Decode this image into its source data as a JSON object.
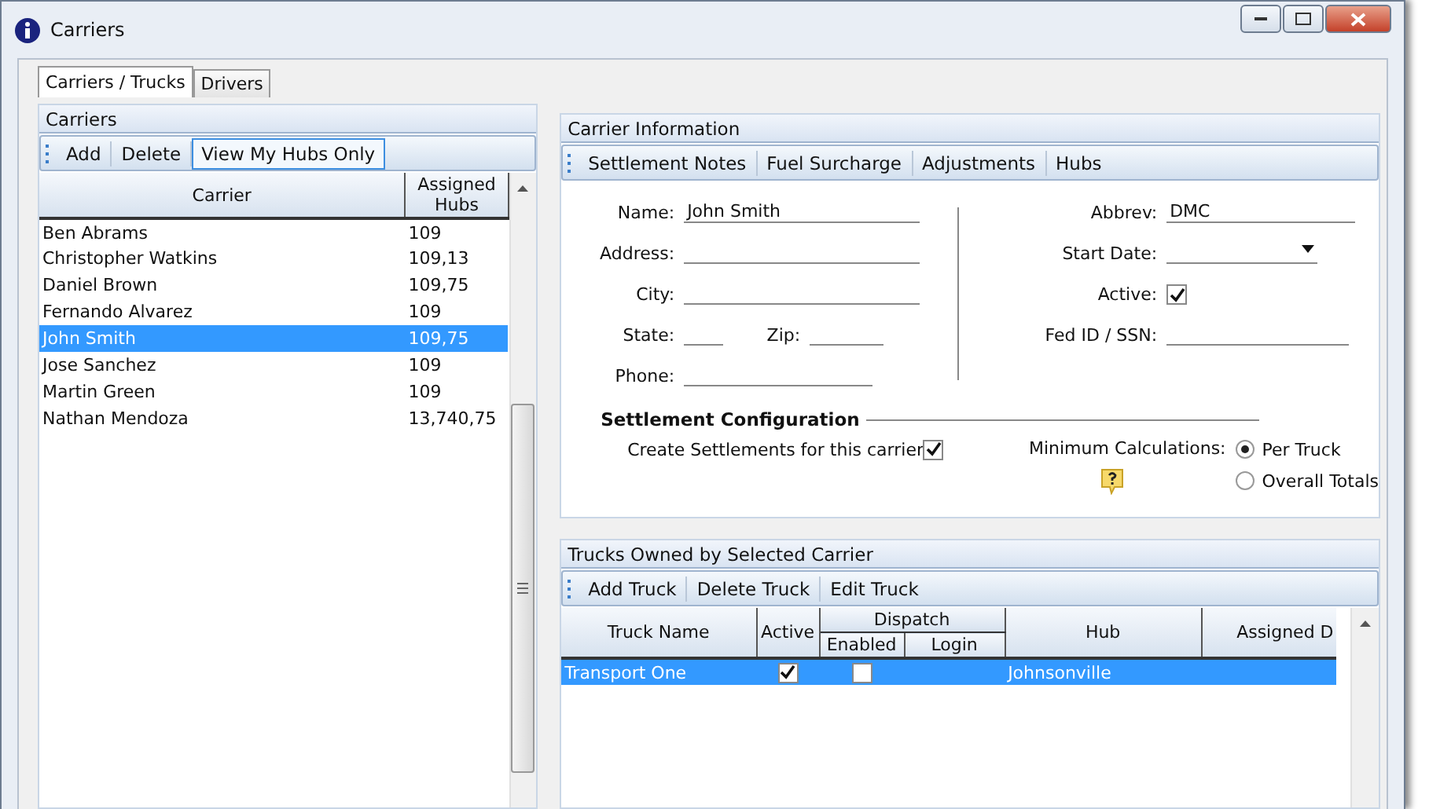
{
  "window": {
    "title": "Carriers"
  },
  "tabs": [
    {
      "label": "Carriers / Trucks",
      "selected": true
    },
    {
      "label": "Drivers",
      "selected": false
    }
  ],
  "carriers": {
    "title": "Carriers",
    "toolbar": [
      {
        "label": "Add",
        "highlighted": false
      },
      {
        "label": "Delete",
        "highlighted": false
      },
      {
        "label": "View My Hubs Only",
        "highlighted": true
      }
    ],
    "columns": [
      "Carrier",
      "Assigned Hubs"
    ],
    "rows": [
      {
        "carrier": "Ben Abrams",
        "hubs": "109",
        "selected": false
      },
      {
        "carrier": "Christopher Watkins",
        "hubs": "109,13",
        "selected": false
      },
      {
        "carrier": "Daniel Brown",
        "hubs": "109,75",
        "selected": false
      },
      {
        "carrier": "Fernando Alvarez",
        "hubs": "109",
        "selected": false
      },
      {
        "carrier": "John Smith",
        "hubs": "109,75",
        "selected": true
      },
      {
        "carrier": "Jose Sanchez",
        "hubs": "109",
        "selected": false
      },
      {
        "carrier": "Martin Green",
        "hubs": "109",
        "selected": false
      },
      {
        "carrier": "Nathan Mendoza",
        "hubs": "13,740,75",
        "selected": false
      }
    ]
  },
  "carrier_info": {
    "title": "Carrier Information",
    "toolbar": [
      "Settlement Notes",
      "Fuel Surcharge",
      "Adjustments",
      "Hubs"
    ],
    "left_fields": [
      {
        "kind": "text",
        "label": "Name:",
        "value": "John Smith"
      },
      {
        "kind": "text",
        "label": "Address:"
      },
      {
        "kind": "text",
        "label": "City:"
      },
      {
        "kind": "pair",
        "label": "State:",
        "label_2": "Zip:"
      },
      {
        "kind": "text",
        "label": "Phone:"
      }
    ],
    "right_fields": [
      {
        "kind": "text",
        "label": "Abbrev:",
        "value": "DMC"
      },
      {
        "kind": "date",
        "label": "Start Date:"
      },
      {
        "kind": "checkbox",
        "label": "Active:",
        "checked": true
      },
      {
        "kind": "text",
        "label": "Fed ID / SSN:"
      }
    ],
    "settlement": {
      "title": "Settlement Configuration",
      "create_label": "Create Settlements for this carrier",
      "create_checked": true,
      "min_label": "Minimum Calculations:",
      "options": [
        {
          "label": "Per Truck",
          "selected": true
        },
        {
          "label": "Overall Totals",
          "selected": false
        }
      ]
    }
  },
  "trucks": {
    "title": "Trucks Owned by Selected Carrier",
    "toolbar": [
      "Add Truck",
      "Delete Truck",
      "Edit Truck"
    ],
    "columns": {
      "name": "Truck Name",
      "active": "Active",
      "dispatch": "Dispatch",
      "enabled": "Enabled",
      "login": "Login",
      "hub": "Hub",
      "column_6": "Assigned D"
    },
    "rows": [
      {
        "name": "Transport One",
        "active": true,
        "dispatch_enabled": false,
        "hub": "Johnsonville",
        "selected": true
      }
    ]
  }
}
